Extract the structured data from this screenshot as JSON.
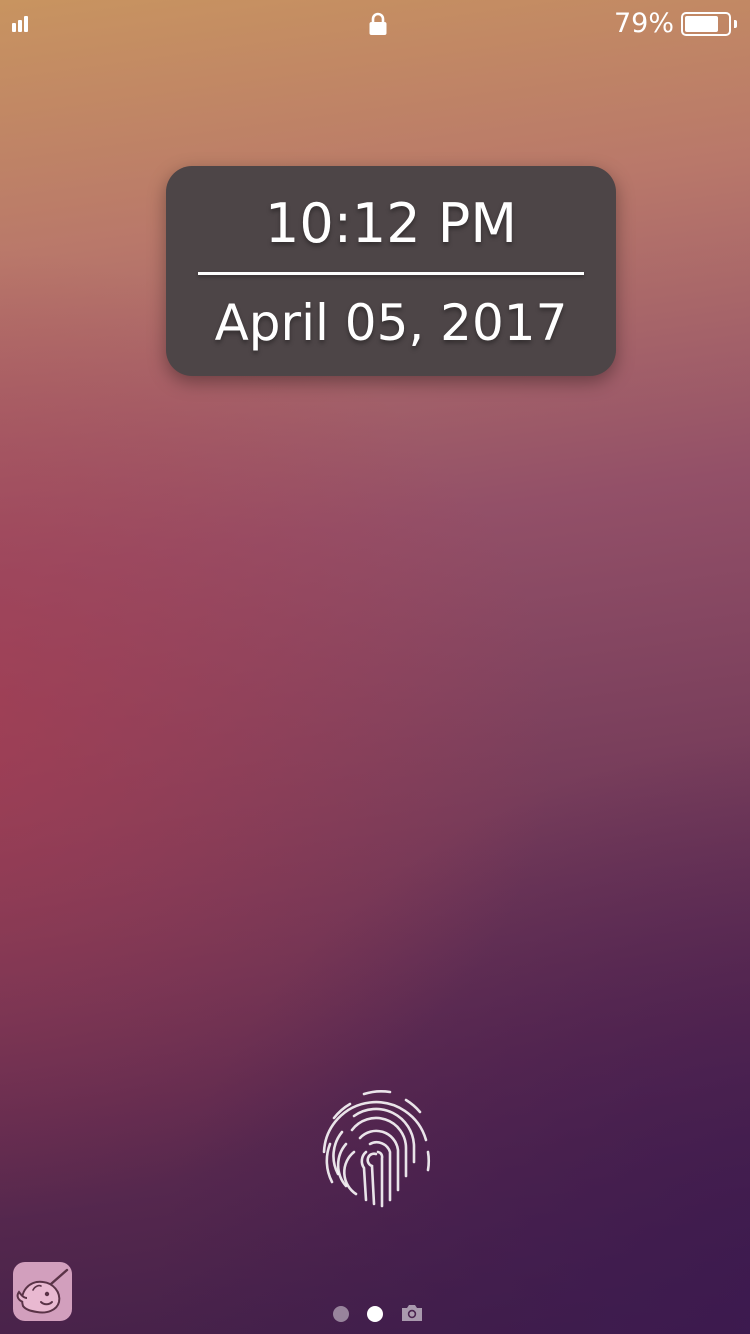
{
  "status_bar": {
    "signal_icon": "signal-bars-icon",
    "lock_icon": "lock-icon",
    "battery_percent_label": "79%",
    "battery_level": 0.79
  },
  "clock": {
    "time": "10:12 PM",
    "date": "April 05, 2017"
  },
  "fingerprint": {
    "icon": "fingerprint-icon"
  },
  "app_badge": {
    "icon": "narwhal-app-icon",
    "color": "#d29fbd"
  },
  "page_indicator": {
    "pages": 3,
    "current_page": 2,
    "last_page_icon": "camera-icon"
  },
  "colors": {
    "card_background": "#4d4547",
    "wallpaper_top": "#c89460",
    "wallpaper_bottom": "#3f1f48"
  }
}
